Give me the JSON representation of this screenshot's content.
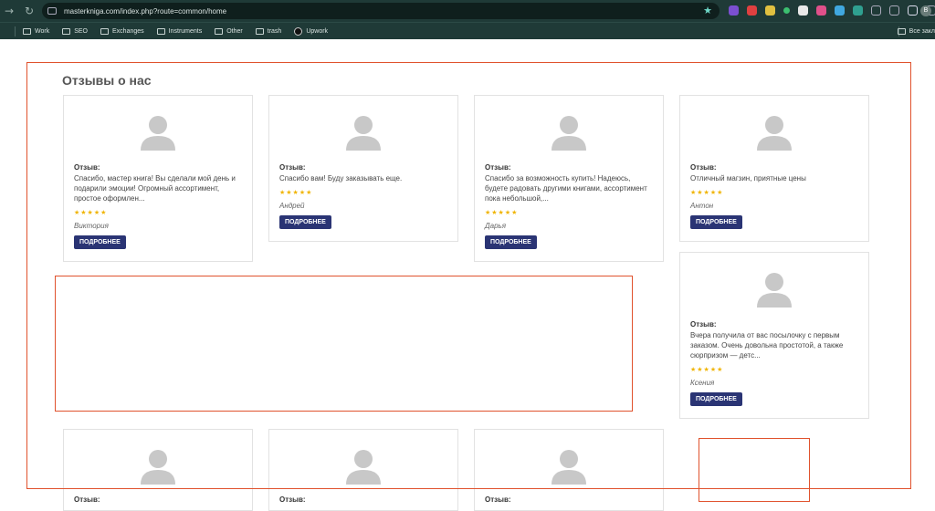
{
  "browser": {
    "url": "masterkniga.com/index.php?route=common/home",
    "profile_letter": "В",
    "bookmarks": [
      {
        "label": "Work"
      },
      {
        "label": "SEO"
      },
      {
        "label": "Exchanges"
      },
      {
        "label": "Instruments"
      },
      {
        "label": "Other"
      },
      {
        "label": "trash"
      },
      {
        "label": "Upwork"
      }
    ],
    "all_bookmarks": "Все закл"
  },
  "section": {
    "title": "Отзывы о нас"
  },
  "review_label": "Отзыв:",
  "stars": "★★★★★",
  "more_label": "ПОДРОБНЕЕ",
  "reviews": [
    {
      "text": "Спасибо, мастер книга! Вы сделали мой день и подарили эмоции! Огромный ассортимент, простое оформлен...",
      "author": "Виктория",
      "rating": 5
    },
    {
      "text": "Спасибо вам! Буду заказывать еще.",
      "author": "Андрей",
      "rating": 5
    },
    {
      "text": "Спасибо за возможность купить! Надеюсь, будете радовать другими книгами, ассортимент пока небольшой,...",
      "author": "Дарья",
      "rating": 5
    },
    {
      "text": "Отличный магзин, приятные цены",
      "author": "Антон",
      "rating": 5
    },
    {
      "text": "Вчера получила от вас посылочку с первым заказом. Очень довольна простотой, а также сюрпризом — детс...",
      "author": "Ксения",
      "rating": 5
    }
  ],
  "partial_cards_label": "Отзыв:"
}
